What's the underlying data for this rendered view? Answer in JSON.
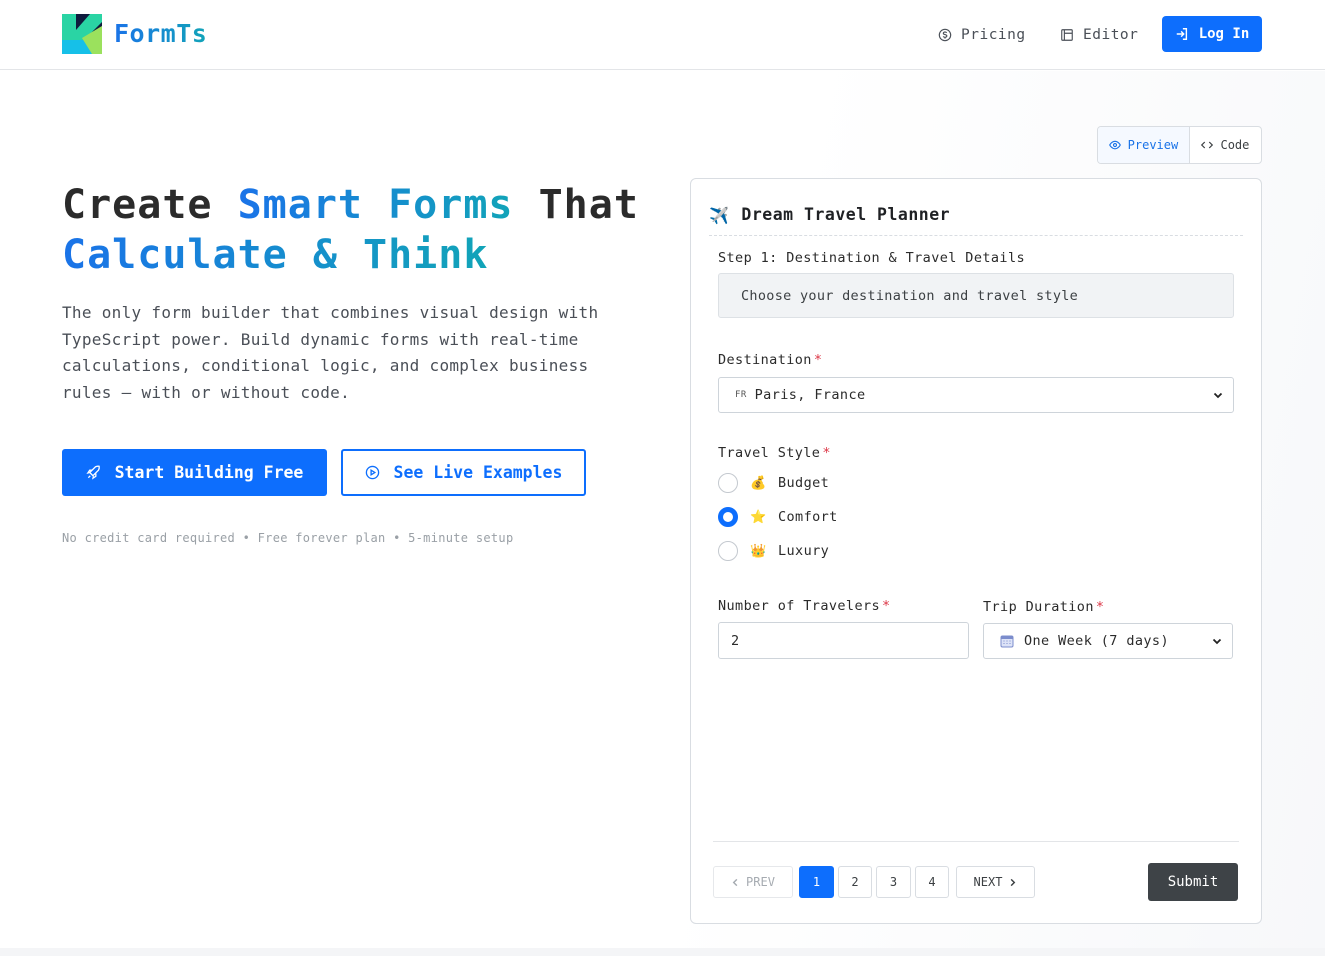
{
  "header": {
    "brand": "FormTs",
    "nav": [
      {
        "label": "Pricing",
        "icon": "dollar-circle-icon"
      },
      {
        "label": "Editor",
        "icon": "editor-icon"
      }
    ],
    "login_label": "Log In"
  },
  "hero": {
    "title_part1": "Create",
    "title_highlight1": "Smart Forms",
    "title_part2": "That",
    "title_highlight2": "Calculate & Think",
    "subtitle": "The only form builder that combines visual design with TypeScript power. Build dynamic forms with real-time calculations, conditional logic, and complex business rules – with or without code.",
    "primary_cta": "Start Building Free",
    "secondary_cta": "See Live Examples",
    "fine_print": "No credit card required • Free forever plan • 5-minute setup"
  },
  "toggle": {
    "preview": "Preview",
    "code": "Code",
    "active": "Preview"
  },
  "form": {
    "title_icon": "✈️",
    "title": "Dream Travel Planner",
    "step_label": "Step 1: Destination & Travel Details",
    "step_description": "Choose your destination and travel style",
    "destination": {
      "label": "Destination",
      "required_mark": "*",
      "flag_code": "FR",
      "value": "Paris, France"
    },
    "travel_style": {
      "label": "Travel Style",
      "required_mark": "*",
      "options": [
        {
          "emoji": "💰",
          "label": "Budget",
          "selected": false
        },
        {
          "emoji": "⭐",
          "label": "Comfort",
          "selected": true
        },
        {
          "emoji": "👑",
          "label": "Luxury",
          "selected": false
        }
      ]
    },
    "travelers": {
      "label": "Number of Travelers",
      "required_mark": "*",
      "value": "2"
    },
    "duration": {
      "label": "Trip Duration",
      "required_mark": "*",
      "value": "One Week (7 days)"
    },
    "pagination": {
      "prev": "PREV",
      "pages": [
        "1",
        "2",
        "3",
        "4"
      ],
      "current_page": "1",
      "next": "NEXT"
    },
    "submit_label": "Submit"
  },
  "colors": {
    "accent": "#0d6efd",
    "gradient_start": "#1a73e8",
    "gradient_end": "#12a4b8",
    "submit_bg": "#3e4347",
    "required": "#dc3545"
  }
}
